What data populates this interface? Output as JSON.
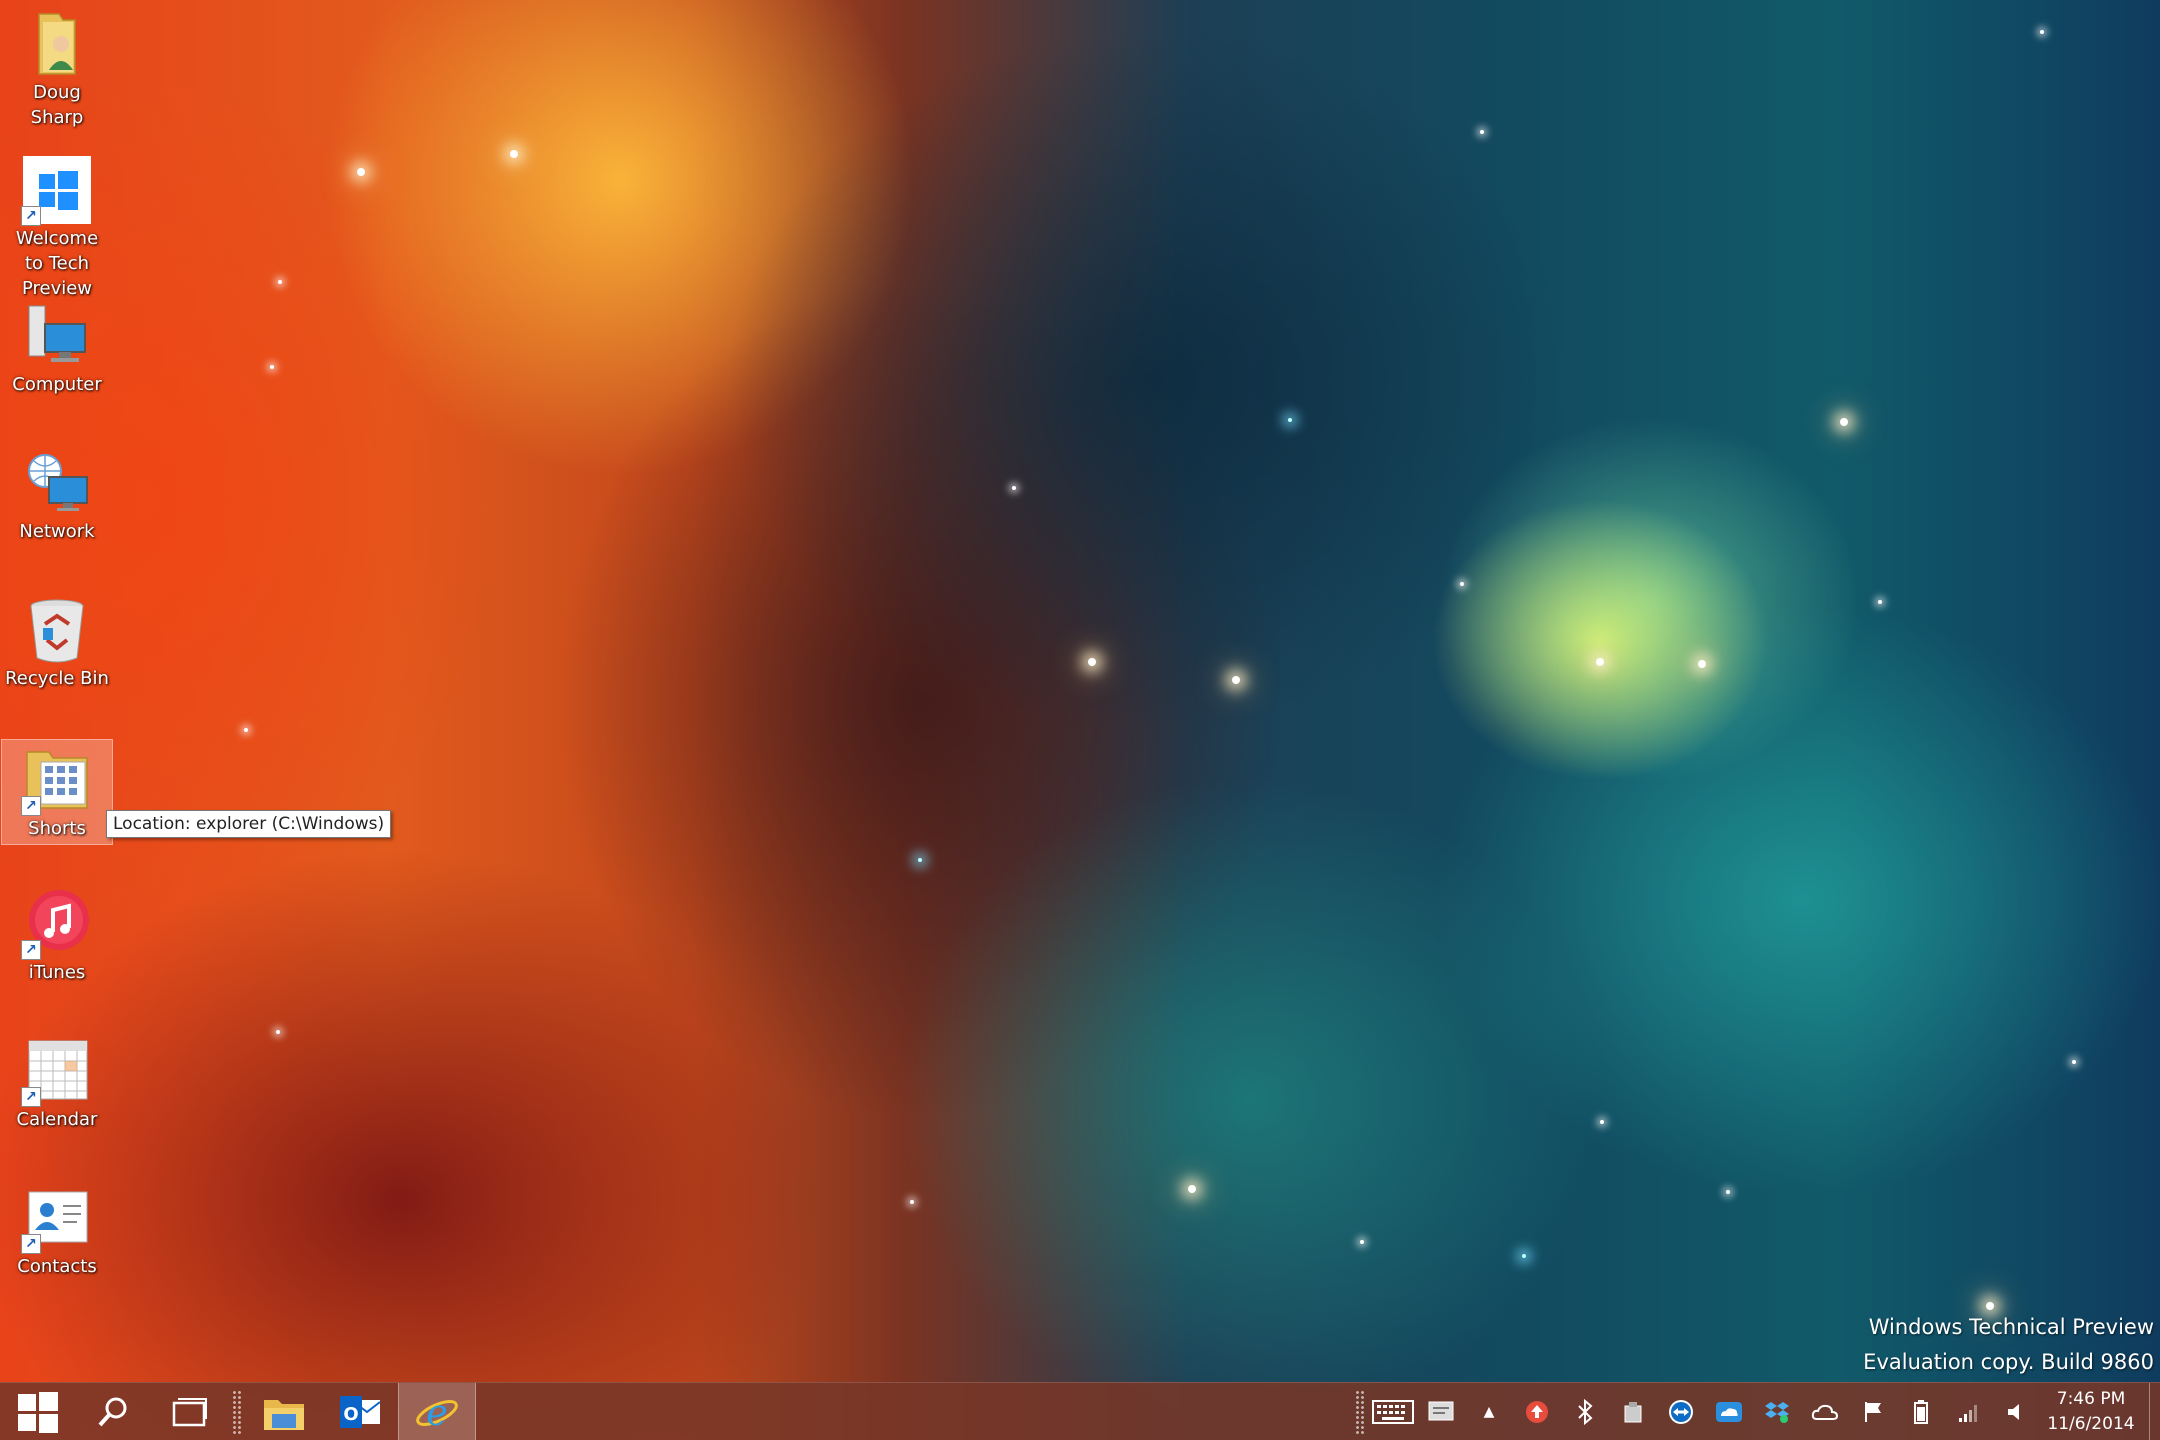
{
  "desktop": {
    "icons": [
      {
        "label": "Doug Sharp",
        "icon": "user-folder-icon"
      },
      {
        "label": "Welcome to Tech Preview",
        "icon": "windows-logo-icon"
      },
      {
        "label": "Computer",
        "icon": "computer-icon"
      },
      {
        "label": "Network",
        "icon": "network-icon"
      },
      {
        "label": "Recycle Bin",
        "icon": "recycle-bin-icon"
      },
      {
        "label": "Shorts",
        "icon": "shortcut-folder-icon"
      },
      {
        "label": "iTunes",
        "icon": "itunes-icon"
      },
      {
        "label": "Calendar",
        "icon": "calendar-icon"
      },
      {
        "label": "Contacts",
        "icon": "contacts-icon"
      }
    ],
    "tooltip": "Location: explorer (C:\\Windows)",
    "watermark": {
      "line1": "Windows Technical Preview",
      "line2": "Evaluation copy. Build 9860"
    }
  },
  "taskbar": {
    "pinned": [
      "start-button",
      "search-button",
      "task-view-button",
      "file-explorer",
      "outlook",
      "internet-explorer"
    ],
    "tray_icons": [
      "touch-keyboard-icon",
      "action-center-icon",
      "show-hidden-icons-chevron",
      "update-arrow-icon",
      "bluetooth-icon",
      "usb-drive-icon",
      "teamviewer-icon",
      "onedrive-icon",
      "dropbox-icon",
      "cloud-icon",
      "flag-icon",
      "battery-icon",
      "signal-icon",
      "volume-icon"
    ],
    "clock": {
      "time": "7:46 PM",
      "date": "11/6/2014"
    }
  },
  "colors": {
    "taskbar": "#78372a",
    "selection": "#ffffff",
    "windows_blue": "#1e90ff"
  }
}
